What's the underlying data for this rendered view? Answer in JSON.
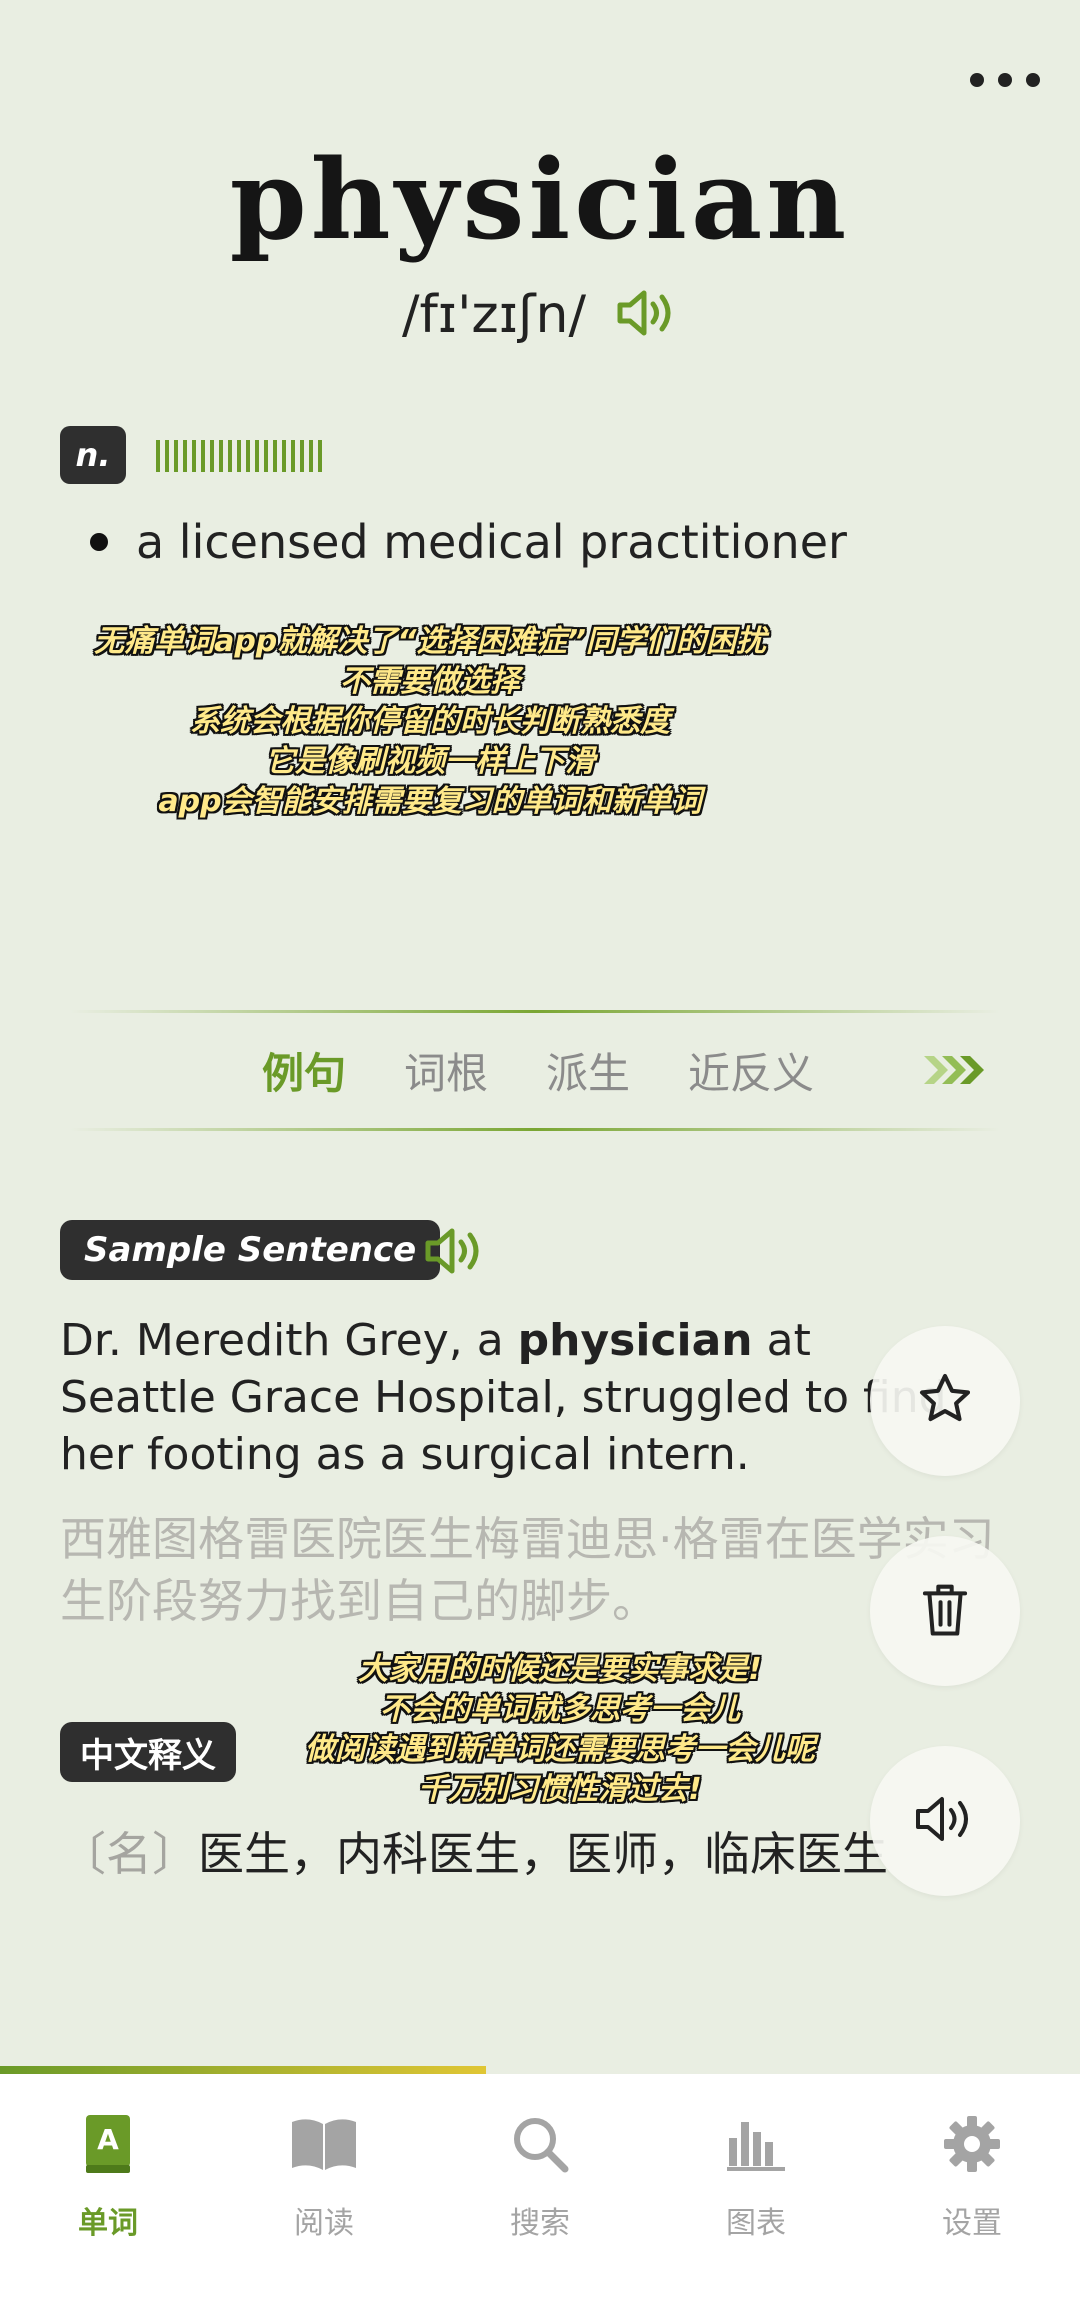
{
  "word": "physician",
  "phonetic": "/fɪ'zɪʃn/",
  "part_of_speech": "n.",
  "frequency_level": 1.0,
  "definition": "a licensed medical practitioner",
  "subtitle_top": [
    "无痛单词app就解决了“选择困难症”同学们的困扰",
    "不需要做选择",
    "系统会根据你停留的时长判断熟悉度",
    "它是像刷视频一样上下滑",
    "app会智能安排需要复习的单词和新单词"
  ],
  "tabs": [
    "例句",
    "词根",
    "派生",
    "近反义"
  ],
  "sample": {
    "badge": "Sample Sentence",
    "sentence_before": "Dr. Meredith Grey, a ",
    "sentence_keyword": "physician",
    "sentence_after": " at Seattle Grace Hospital, struggled to find her footing as a surgical intern.",
    "translation": "西雅图格雷医院医生梅雷迪思·格雷在医学实习生阶段努力找到自己的脚步。"
  },
  "chinese": {
    "badge": "中文释义",
    "prefix": "〔名〕",
    "meaning": "医生，内科医生，医师，临床医生"
  },
  "subtitle_bottom": [
    "大家用的时候还是要实事求是!",
    "不会的单词就多思考一会儿",
    "做阅读遇到新单词还需要思考一会儿呢",
    "千万别习惯性滑过去!"
  ],
  "fab_icons": [
    "star-icon",
    "trash-icon",
    "speaker-icon"
  ],
  "progress": 0.45,
  "nav": [
    {
      "label": "单词",
      "icon": "vocab-book-icon",
      "active": true
    },
    {
      "label": "阅读",
      "icon": "open-book-icon",
      "active": false
    },
    {
      "label": "搜索",
      "icon": "search-icon",
      "active": false
    },
    {
      "label": "图表",
      "icon": "bar-chart-icon",
      "active": false
    },
    {
      "label": "设置",
      "icon": "gear-icon",
      "active": false
    }
  ],
  "colors": {
    "accent": "#6a9a28",
    "background": "#e9eee2",
    "badge": "#2f2f2f"
  }
}
